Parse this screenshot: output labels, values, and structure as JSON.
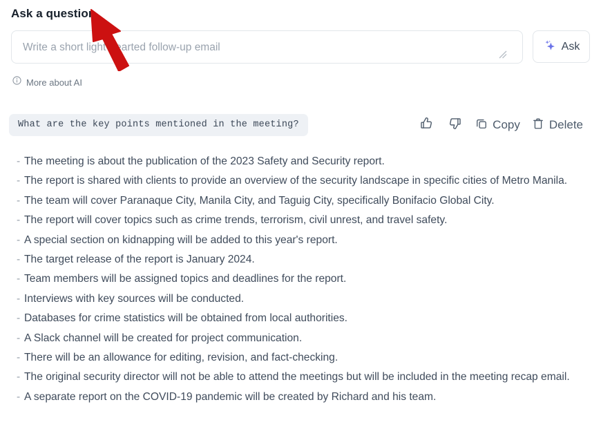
{
  "header": {
    "title": "Ask a question"
  },
  "composer": {
    "input_value": "",
    "placeholder": "Write a short light-hearted follow-up email",
    "ask_label": "Ask",
    "sparkle_icon": "sparkle-icon",
    "resize_handle": "resize-grip"
  },
  "disclaimer": {
    "info_icon": "info-icon",
    "label": "More about AI"
  },
  "answer": {
    "question": "What are the key points mentioned in the meeting?",
    "actions": [
      {
        "name": "thumbs-up",
        "icon": "thumbs-up-icon",
        "label": ""
      },
      {
        "name": "thumbs-down",
        "icon": "thumbs-down-icon",
        "label": ""
      },
      {
        "name": "copy",
        "icon": "copy-icon",
        "label": "Copy"
      },
      {
        "name": "delete",
        "icon": "trash-icon",
        "label": "Delete"
      }
    ],
    "bullet_marker": "-",
    "bullets": [
      "The meeting is about the publication of the 2023 Safety and Security report.",
      "The report is shared with clients to provide an overview of the security landscape in specific cities of Metro Manila.",
      "The team will cover Paranaque City, Manila City, and Taguig City, specifically Bonifacio Global City.",
      "The report will cover topics such as crime trends, terrorism, civil unrest, and travel safety.",
      "A special section on kidnapping will be added to this year's report.",
      "The target release of the report is January 2024.",
      "Team members will be assigned topics and deadlines for the report.",
      "Interviews with key sources will be conducted.",
      "Databases for crime statistics will be obtained from local authorities.",
      "A Slack channel will be created for project communication.",
      "There will be an allowance for editing, revision, and fact-checking.",
      "The original security director will not be able to attend the meetings but will be included in the meeting recap email.",
      "A separate report on the COVID-19 pandemic will be created by Richard and his team."
    ]
  },
  "annotation": {
    "arrow_color": "#cc1111",
    "points_to": "Ask a question"
  },
  "colors": {
    "accent": "#6b73e8",
    "text": "#3f4b5b",
    "muted": "#9aa3ae",
    "chip_bg": "#eef1f5",
    "border": "#e2e6ea"
  }
}
